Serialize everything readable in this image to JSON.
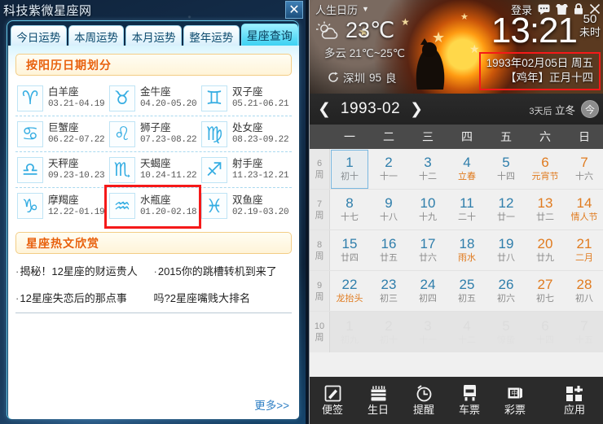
{
  "zodiac_window": {
    "title": "科技紫微星座网",
    "close_label": "✕",
    "tabs": [
      {
        "label": "今日运势",
        "active": false
      },
      {
        "label": "本周运势",
        "active": false
      },
      {
        "label": "本月运势",
        "active": false
      },
      {
        "label": "整年运势",
        "active": false
      },
      {
        "label": "星座查询",
        "active": true
      }
    ],
    "section1_header": "按阳历日期划分",
    "signs": [
      {
        "name": "白羊座",
        "date": "03.21-04.19",
        "glyph": "♈",
        "highlight": false
      },
      {
        "name": "金牛座",
        "date": "04.20-05.20",
        "glyph": "♉",
        "highlight": false
      },
      {
        "name": "双子座",
        "date": "05.21-06.21",
        "glyph": "♊",
        "highlight": false
      },
      {
        "name": "巨蟹座",
        "date": "06.22-07.22",
        "glyph": "♋",
        "highlight": false
      },
      {
        "name": "狮子座",
        "date": "07.23-08.22",
        "glyph": "♌",
        "highlight": false
      },
      {
        "name": "处女座",
        "date": "08.23-09.22",
        "glyph": "♍",
        "highlight": false
      },
      {
        "name": "天秤座",
        "date": "09.23-10.23",
        "glyph": "♎",
        "highlight": false
      },
      {
        "name": "天蝎座",
        "date": "10.24-11.22",
        "glyph": "♏",
        "highlight": false
      },
      {
        "name": "射手座",
        "date": "11.23-12.21",
        "glyph": "♐",
        "highlight": false
      },
      {
        "name": "摩羯座",
        "date": "12.22-01.19",
        "glyph": "♑",
        "highlight": false
      },
      {
        "name": "水瓶座",
        "date": "01.20-02.18",
        "glyph": "♒",
        "highlight": true
      },
      {
        "name": "双鱼座",
        "date": "02.19-03.20",
        "glyph": "♓",
        "highlight": false
      }
    ],
    "section2_header": "星座热文欣赏",
    "articles": [
      "揭秘！12星座的财运贵人",
      "2015你的跳槽转机到来了",
      "12星座失恋后的那点事",
      "吗?2星座嘴贱大排名"
    ],
    "more_label": "更多>>"
  },
  "calendar_window": {
    "app_name": "人生日历",
    "login_label": "登录",
    "top_icons": [
      "message-icon",
      "skin-icon",
      "lock-icon",
      "close-icon"
    ],
    "weather": {
      "temp": "23℃",
      "desc": "多云 21℃~25℃",
      "city": "深圳",
      "aqi": "95",
      "aqi_level": "良",
      "icon": "sun-cloud-icon"
    },
    "clock": {
      "time": "13:21",
      "seconds": "50",
      "shichen": "未时"
    },
    "date_box": {
      "solar": "1993年02月05日 周五",
      "lunar": "【鸡年】正月十四"
    },
    "nav": {
      "prev": "❮",
      "next": "❯",
      "month": "1993-02",
      "term_days": "3天后",
      "term_name": "立冬",
      "today_label": "今"
    },
    "weekdays": [
      "一",
      "二",
      "三",
      "四",
      "五",
      "六",
      "日"
    ],
    "weeknum_suffix": "周",
    "grid": [
      {
        "weeknum": "6",
        "cells": [
          {
            "d": "1",
            "l": "初十",
            "weekend": false,
            "festival": false,
            "term": false,
            "out": false,
            "selected": false
          },
          {
            "d": "2",
            "l": "十一",
            "weekend": false,
            "festival": false,
            "term": false,
            "out": false,
            "selected": false
          },
          {
            "d": "3",
            "l": "十二",
            "weekend": false,
            "festival": false,
            "term": false,
            "out": false,
            "selected": false
          },
          {
            "d": "4",
            "l": "立春",
            "weekend": false,
            "festival": false,
            "term": true,
            "out": false,
            "selected": false
          },
          {
            "d": "5",
            "l": "十四",
            "weekend": false,
            "festival": false,
            "term": false,
            "out": false,
            "selected": true
          },
          {
            "d": "6",
            "l": "元宵节",
            "weekend": true,
            "festival": true,
            "term": false,
            "out": false,
            "selected": false
          },
          {
            "d": "7",
            "l": "十六",
            "weekend": true,
            "festival": false,
            "term": false,
            "out": false,
            "selected": false
          }
        ]
      },
      {
        "weeknum": "7",
        "cells": [
          {
            "d": "8",
            "l": "十七",
            "weekend": false,
            "festival": false,
            "term": false,
            "out": false,
            "selected": false
          },
          {
            "d": "9",
            "l": "十八",
            "weekend": false,
            "festival": false,
            "term": false,
            "out": false,
            "selected": false
          },
          {
            "d": "10",
            "l": "十九",
            "weekend": false,
            "festival": false,
            "term": false,
            "out": false,
            "selected": false
          },
          {
            "d": "11",
            "l": "二十",
            "weekend": false,
            "festival": false,
            "term": false,
            "out": false,
            "selected": false
          },
          {
            "d": "12",
            "l": "廿一",
            "weekend": false,
            "festival": false,
            "term": false,
            "out": false,
            "selected": false
          },
          {
            "d": "13",
            "l": "廿二",
            "weekend": true,
            "festival": false,
            "term": false,
            "out": false,
            "selected": false
          },
          {
            "d": "14",
            "l": "情人节",
            "weekend": true,
            "festival": true,
            "term": false,
            "out": false,
            "selected": false
          }
        ]
      },
      {
        "weeknum": "8",
        "cells": [
          {
            "d": "15",
            "l": "廿四",
            "weekend": false,
            "festival": false,
            "term": false,
            "out": false,
            "selected": false
          },
          {
            "d": "16",
            "l": "廿五",
            "weekend": false,
            "festival": false,
            "term": false,
            "out": false,
            "selected": false
          },
          {
            "d": "17",
            "l": "廿六",
            "weekend": false,
            "festival": false,
            "term": false,
            "out": false,
            "selected": false
          },
          {
            "d": "18",
            "l": "雨水",
            "weekend": false,
            "festival": false,
            "term": true,
            "out": false,
            "selected": false
          },
          {
            "d": "19",
            "l": "廿八",
            "weekend": false,
            "festival": false,
            "term": false,
            "out": false,
            "selected": false
          },
          {
            "d": "20",
            "l": "廿九",
            "weekend": true,
            "festival": false,
            "term": false,
            "out": false,
            "selected": false
          },
          {
            "d": "21",
            "l": "二月",
            "weekend": true,
            "festival": true,
            "term": false,
            "out": false,
            "selected": false
          }
        ]
      },
      {
        "weeknum": "9",
        "cells": [
          {
            "d": "22",
            "l": "龙抬头",
            "weekend": false,
            "festival": true,
            "term": false,
            "out": false,
            "selected": false
          },
          {
            "d": "23",
            "l": "初三",
            "weekend": false,
            "festival": false,
            "term": false,
            "out": false,
            "selected": false
          },
          {
            "d": "24",
            "l": "初四",
            "weekend": false,
            "festival": false,
            "term": false,
            "out": false,
            "selected": false
          },
          {
            "d": "25",
            "l": "初五",
            "weekend": false,
            "festival": false,
            "term": false,
            "out": false,
            "selected": false
          },
          {
            "d": "26",
            "l": "初六",
            "weekend": false,
            "festival": false,
            "term": false,
            "out": false,
            "selected": false
          },
          {
            "d": "27",
            "l": "初七",
            "weekend": true,
            "festival": false,
            "term": false,
            "out": false,
            "selected": false
          },
          {
            "d": "28",
            "l": "初八",
            "weekend": true,
            "festival": false,
            "term": false,
            "out": false,
            "selected": false
          }
        ]
      },
      {
        "weeknum": "10",
        "out_row": true,
        "cells": [
          {
            "d": "1",
            "l": "初九",
            "weekend": false,
            "festival": false,
            "term": false,
            "out": true,
            "selected": false
          },
          {
            "d": "2",
            "l": "初十",
            "weekend": false,
            "festival": false,
            "term": false,
            "out": true,
            "selected": false
          },
          {
            "d": "3",
            "l": "十一",
            "weekend": false,
            "festival": false,
            "term": false,
            "out": true,
            "selected": false
          },
          {
            "d": "4",
            "l": "十二",
            "weekend": false,
            "festival": false,
            "term": false,
            "out": true,
            "selected": false
          },
          {
            "d": "5",
            "l": "惊蛰",
            "weekend": false,
            "festival": false,
            "term": false,
            "out": true,
            "selected": false
          },
          {
            "d": "6",
            "l": "十四",
            "weekend": false,
            "festival": false,
            "term": false,
            "out": true,
            "selected": false
          },
          {
            "d": "7",
            "l": "十五",
            "weekend": false,
            "festival": false,
            "term": false,
            "out": true,
            "selected": false
          }
        ]
      }
    ],
    "toolbar": [
      {
        "label": "便签",
        "icon": "note-pencil-icon"
      },
      {
        "label": "生日",
        "icon": "birthday-cake-icon"
      },
      {
        "label": "提醒",
        "icon": "alarm-clock-icon"
      },
      {
        "label": "车票",
        "icon": "train-ticket-icon"
      },
      {
        "label": "彩票",
        "icon": "lottery-icon"
      }
    ],
    "apps_button": {
      "label": "应用",
      "icon": "apps-grid-plus-icon"
    }
  }
}
